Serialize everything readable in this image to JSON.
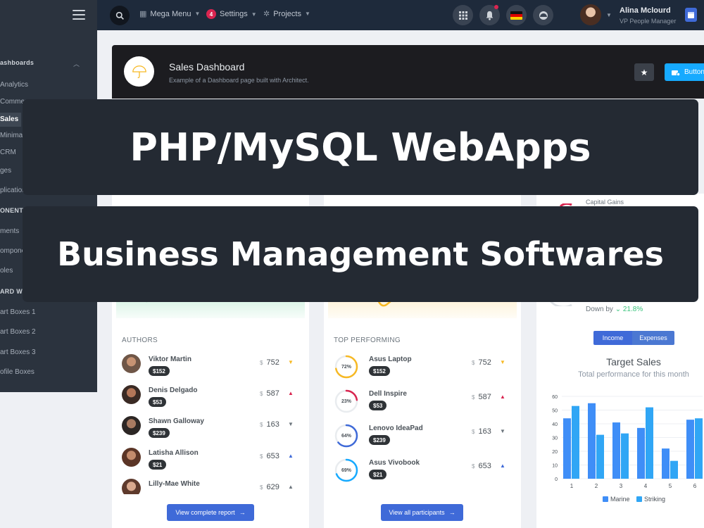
{
  "header": {
    "nav": [
      {
        "label": "Mega Menu"
      },
      {
        "label": "Settings",
        "badge": "4"
      },
      {
        "label": "Projects"
      }
    ],
    "user": {
      "name": "Alina Mclourd",
      "role": "VP People Manager"
    }
  },
  "sidebar": {
    "sections": [
      {
        "title": "ashboards",
        "items": [
          "Analytics",
          "Commer",
          "Sales",
          "Minima",
          "CRM",
          "ges",
          "plication"
        ]
      },
      {
        "title": "ONENTS",
        "items": [
          "ments",
          "ompone",
          "oles"
        ]
      },
      {
        "title": "ARD WI",
        "items": [
          "art Boxes 1",
          "art Boxes 2",
          "art Boxes 3",
          "ofile Boxes"
        ]
      }
    ],
    "active_item": "Sales"
  },
  "page_title": {
    "title": "Sales Dashboard",
    "subtitle": "Example of a Dashboard page built with Architect.",
    "button_label": "Button"
  },
  "authors": {
    "title": "AUTHORS",
    "rows": [
      {
        "name": "Viktor Martin",
        "pill": "$152",
        "value": "752",
        "trend": "down"
      },
      {
        "name": "Denis Delgado",
        "pill": "$53",
        "value": "587",
        "trend": "up"
      },
      {
        "name": "Shawn Galloway",
        "pill": "$239",
        "value": "163",
        "trend": "down"
      },
      {
        "name": "Latisha Allison",
        "pill": "$21",
        "value": "653",
        "trend": "up"
      },
      {
        "name": "Lilly-Mae White",
        "pill": "",
        "value": "629",
        "trend": "up"
      }
    ],
    "currency": "$",
    "footer_label": "View complete report"
  },
  "top_performing": {
    "title": "TOP PERFORMING",
    "rows": [
      {
        "name": "Asus Laptop",
        "pill": "$152",
        "percent_label": "72%",
        "percent": 72,
        "color": "#f7b924",
        "value": "752",
        "trend": "down"
      },
      {
        "name": "Dell Inspire",
        "pill": "$53",
        "percent_label": "23%",
        "percent": 23,
        "color": "#d92550",
        "value": "587",
        "trend": "up"
      },
      {
        "name": "Lenovo IdeaPad",
        "pill": "$239",
        "percent_label": "64%",
        "percent": 64,
        "color": "#3f6ad8",
        "value": "163",
        "trend": "down"
      },
      {
        "name": "Asus Vivobook",
        "pill": "$21",
        "percent_label": "69%",
        "percent": 69,
        "color": "#16aaff",
        "value": "653",
        "trend": "up"
      }
    ],
    "currency": "$",
    "footer_label": "View all participants"
  },
  "target_card": {
    "capital_gains": "Capital Gains",
    "down_by": "Down by",
    "down_pct": "21.8%",
    "tabs": [
      "Income",
      "Expenses"
    ],
    "title": "Target Sales",
    "subtitle": "Total performance for this month"
  },
  "chart_data": {
    "type": "bar",
    "title": "Target Sales",
    "categories": [
      "1",
      "2",
      "3",
      "4",
      "5",
      "6"
    ],
    "series": [
      {
        "name": "Marine",
        "values": [
          44,
          55,
          41,
          37,
          22,
          43
        ],
        "color": "#3f8ef7"
      },
      {
        "name": "Striking",
        "values": [
          53,
          32,
          33,
          52,
          13,
          44
        ],
        "color": "#30a6f5"
      }
    ],
    "ylim": [
      0,
      60
    ],
    "yticks": [
      0,
      10,
      20,
      30,
      40,
      50,
      60
    ],
    "legend": "bottom"
  },
  "overlay": {
    "line1": "PHP/MySQL WebApps",
    "line2": "Business Management Softwares"
  },
  "colors": {
    "primary": "#3f6ad8",
    "info": "#16aaff",
    "success": "#3ac47d",
    "danger": "#d92550",
    "warning": "#f7b924"
  }
}
